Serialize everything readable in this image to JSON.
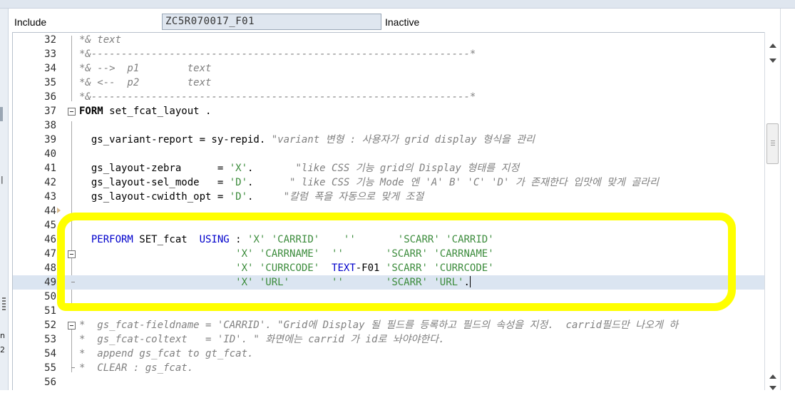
{
  "header": {
    "include_label": "Include",
    "include_name": "ZC5R070017_F01",
    "status": "Inactive"
  },
  "left_fragments": {
    "a": "n",
    "b": "2"
  },
  "colors": {
    "highlight": "#ffff00",
    "keyword": "#0000cc",
    "string": "#3c8c3c",
    "comment": "#808080",
    "current_line": "#dbe5f1"
  },
  "lines": [
    {
      "num": "32",
      "code": "*& text"
    },
    {
      "num": "33",
      "code": "*&---------------------------------------------------------------*"
    },
    {
      "num": "34",
      "code": "*& -->  p1        text"
    },
    {
      "num": "35",
      "code": "*& <--  p2        text"
    },
    {
      "num": "36",
      "code": "*&---------------------------------------------------------------*"
    },
    {
      "num": "37",
      "code_form_kw": "FORM",
      "code_form_rest": " set_fcat_layout ."
    },
    {
      "num": "38",
      "code": ""
    },
    {
      "num": "39",
      "code_a": "  gs_variant-report = sy-repid. ",
      "code_b": "\"variant 변형 : 사용자가 grid display 형식을 관리"
    },
    {
      "num": "40",
      "code": ""
    },
    {
      "num": "41",
      "code_a": "  gs_layout-zebra      = ",
      "str": "'X'",
      "code_c": ".      ",
      "cm": " \"like CSS 기능 grid의 Display 형태를 지정"
    },
    {
      "num": "42",
      "code_a": "  gs_layout-sel_mode   = ",
      "str": "'D'",
      "code_c": ".      ",
      "cm": "\" like CSS 기능 Mode 엔 'A' B' 'C' 'D' 가 존재한다 입맛에 맞게 골라리"
    },
    {
      "num": "43",
      "code_a": "  gs_layout-cwidth_opt = ",
      "str": "'D'",
      "code_c": ".     ",
      "cm": "\"칼럼 폭을 자동으로 맞게 조절"
    },
    {
      "num": "44",
      "code": ""
    },
    {
      "num": "45",
      "code": ""
    },
    {
      "num": "46",
      "perform": "  PERFORM",
      "name": " SET_fcat  ",
      "using": "USING",
      "colon": " : ",
      "s1": "'X'",
      "s2": " 'CARRID'",
      "s3": "    ''",
      "s4": "       'SCARR'",
      "s5": " 'CARRID'"
    },
    {
      "num": "47",
      "pad": "                          ",
      "s1": "'X'",
      "s2": " 'CARRNAME'",
      "s3": "  ''",
      "s4": "       'SCARR'",
      "s5": " 'CARRNAME'"
    },
    {
      "num": "48",
      "pad": "                          ",
      "s1": "'X'",
      "s2": " 'CURRCODE'",
      "kw": "  TEXT",
      "t2": "-F01",
      "s4": " 'SCARR'",
      "s5": " 'CURRCODE'"
    },
    {
      "num": "49",
      "pad": "                          ",
      "s1": "'X'",
      "s2": " 'URL'",
      "s3": "       ''",
      "s4": "       'SCARR'",
      "s5": " 'URL'",
      "end": "."
    },
    {
      "num": "50",
      "code": ""
    },
    {
      "num": "51",
      "code": ""
    },
    {
      "num": "52",
      "code": "*  gs_fcat-fieldname = 'CARRID'. \"Grid에 Display 될 필드를 등록하고 필드의 속성을 지정.  carrid필드만 나오게 하"
    },
    {
      "num": "53",
      "code": "*  gs_fcat-coltext   = 'ID'. \" 화면에는 carrid 가 id로 놔야야한다."
    },
    {
      "num": "54",
      "code": "*  append gs_fcat to gt_fcat."
    },
    {
      "num": "55",
      "code": "*  CLEAR : gs_fcat."
    },
    {
      "num": "56",
      "code": ""
    }
  ]
}
